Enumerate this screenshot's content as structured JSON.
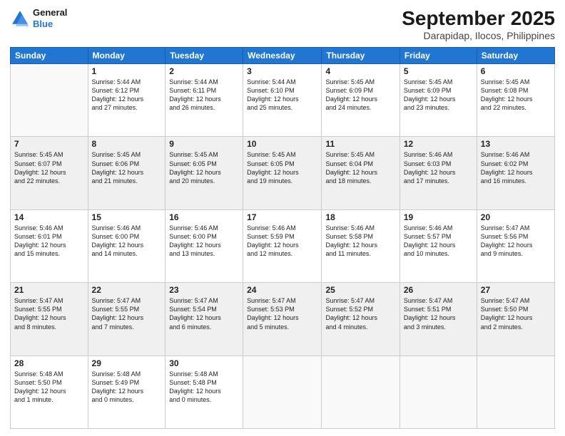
{
  "header": {
    "logo_line1": "General",
    "logo_line2": "Blue",
    "month": "September 2025",
    "location": "Darapidap, Ilocos, Philippines"
  },
  "days_of_week": [
    "Sunday",
    "Monday",
    "Tuesday",
    "Wednesday",
    "Thursday",
    "Friday",
    "Saturday"
  ],
  "weeks": [
    [
      {
        "day": "",
        "text": ""
      },
      {
        "day": "1",
        "text": "Sunrise: 5:44 AM\nSunset: 6:12 PM\nDaylight: 12 hours\nand 27 minutes."
      },
      {
        "day": "2",
        "text": "Sunrise: 5:44 AM\nSunset: 6:11 PM\nDaylight: 12 hours\nand 26 minutes."
      },
      {
        "day": "3",
        "text": "Sunrise: 5:44 AM\nSunset: 6:10 PM\nDaylight: 12 hours\nand 25 minutes."
      },
      {
        "day": "4",
        "text": "Sunrise: 5:45 AM\nSunset: 6:09 PM\nDaylight: 12 hours\nand 24 minutes."
      },
      {
        "day": "5",
        "text": "Sunrise: 5:45 AM\nSunset: 6:09 PM\nDaylight: 12 hours\nand 23 minutes."
      },
      {
        "day": "6",
        "text": "Sunrise: 5:45 AM\nSunset: 6:08 PM\nDaylight: 12 hours\nand 22 minutes."
      }
    ],
    [
      {
        "day": "7",
        "text": "Sunrise: 5:45 AM\nSunset: 6:07 PM\nDaylight: 12 hours\nand 22 minutes."
      },
      {
        "day": "8",
        "text": "Sunrise: 5:45 AM\nSunset: 6:06 PM\nDaylight: 12 hours\nand 21 minutes."
      },
      {
        "day": "9",
        "text": "Sunrise: 5:45 AM\nSunset: 6:05 PM\nDaylight: 12 hours\nand 20 minutes."
      },
      {
        "day": "10",
        "text": "Sunrise: 5:45 AM\nSunset: 6:05 PM\nDaylight: 12 hours\nand 19 minutes."
      },
      {
        "day": "11",
        "text": "Sunrise: 5:45 AM\nSunset: 6:04 PM\nDaylight: 12 hours\nand 18 minutes."
      },
      {
        "day": "12",
        "text": "Sunrise: 5:46 AM\nSunset: 6:03 PM\nDaylight: 12 hours\nand 17 minutes."
      },
      {
        "day": "13",
        "text": "Sunrise: 5:46 AM\nSunset: 6:02 PM\nDaylight: 12 hours\nand 16 minutes."
      }
    ],
    [
      {
        "day": "14",
        "text": "Sunrise: 5:46 AM\nSunset: 6:01 PM\nDaylight: 12 hours\nand 15 minutes."
      },
      {
        "day": "15",
        "text": "Sunrise: 5:46 AM\nSunset: 6:00 PM\nDaylight: 12 hours\nand 14 minutes."
      },
      {
        "day": "16",
        "text": "Sunrise: 5:46 AM\nSunset: 6:00 PM\nDaylight: 12 hours\nand 13 minutes."
      },
      {
        "day": "17",
        "text": "Sunrise: 5:46 AM\nSunset: 5:59 PM\nDaylight: 12 hours\nand 12 minutes."
      },
      {
        "day": "18",
        "text": "Sunrise: 5:46 AM\nSunset: 5:58 PM\nDaylight: 12 hours\nand 11 minutes."
      },
      {
        "day": "19",
        "text": "Sunrise: 5:46 AM\nSunset: 5:57 PM\nDaylight: 12 hours\nand 10 minutes."
      },
      {
        "day": "20",
        "text": "Sunrise: 5:47 AM\nSunset: 5:56 PM\nDaylight: 12 hours\nand 9 minutes."
      }
    ],
    [
      {
        "day": "21",
        "text": "Sunrise: 5:47 AM\nSunset: 5:55 PM\nDaylight: 12 hours\nand 8 minutes."
      },
      {
        "day": "22",
        "text": "Sunrise: 5:47 AM\nSunset: 5:55 PM\nDaylight: 12 hours\nand 7 minutes."
      },
      {
        "day": "23",
        "text": "Sunrise: 5:47 AM\nSunset: 5:54 PM\nDaylight: 12 hours\nand 6 minutes."
      },
      {
        "day": "24",
        "text": "Sunrise: 5:47 AM\nSunset: 5:53 PM\nDaylight: 12 hours\nand 5 minutes."
      },
      {
        "day": "25",
        "text": "Sunrise: 5:47 AM\nSunset: 5:52 PM\nDaylight: 12 hours\nand 4 minutes."
      },
      {
        "day": "26",
        "text": "Sunrise: 5:47 AM\nSunset: 5:51 PM\nDaylight: 12 hours\nand 3 minutes."
      },
      {
        "day": "27",
        "text": "Sunrise: 5:47 AM\nSunset: 5:50 PM\nDaylight: 12 hours\nand 2 minutes."
      }
    ],
    [
      {
        "day": "28",
        "text": "Sunrise: 5:48 AM\nSunset: 5:50 PM\nDaylight: 12 hours\nand 1 minute."
      },
      {
        "day": "29",
        "text": "Sunrise: 5:48 AM\nSunset: 5:49 PM\nDaylight: 12 hours\nand 0 minutes."
      },
      {
        "day": "30",
        "text": "Sunrise: 5:48 AM\nSunset: 5:48 PM\nDaylight: 12 hours\nand 0 minutes."
      },
      {
        "day": "",
        "text": ""
      },
      {
        "day": "",
        "text": ""
      },
      {
        "day": "",
        "text": ""
      },
      {
        "day": "",
        "text": ""
      }
    ]
  ]
}
